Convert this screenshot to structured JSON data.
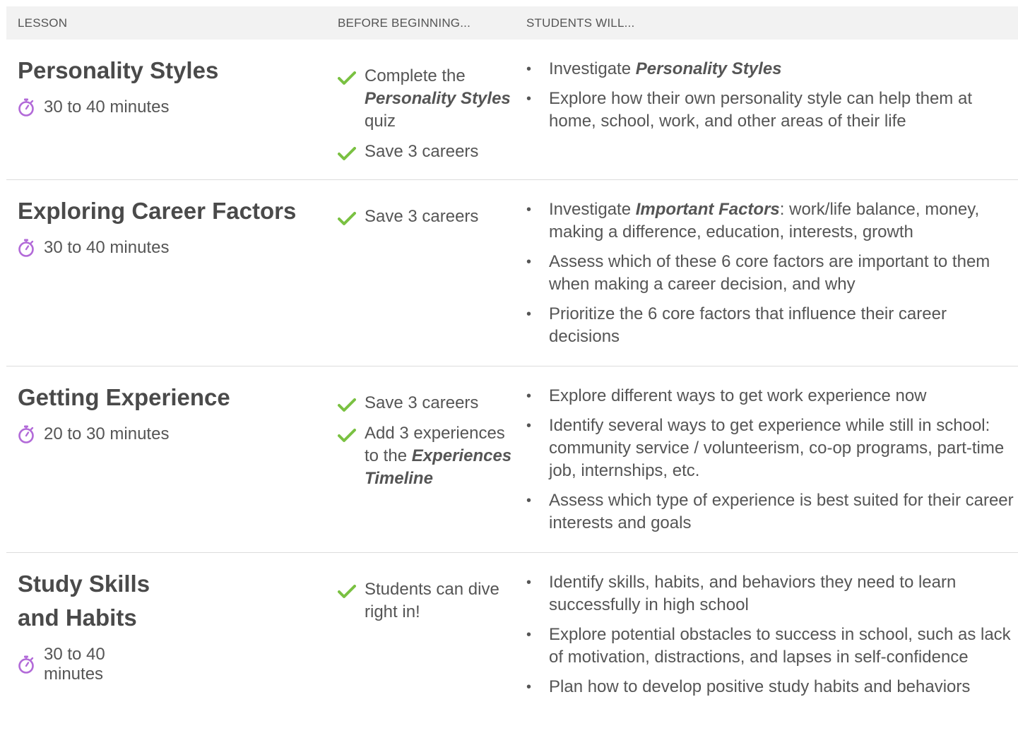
{
  "header": {
    "lesson": "LESSON",
    "before": "BEFORE BEGINNING...",
    "students": "STUDENTS WILL..."
  },
  "colors": {
    "check": "#7ac142",
    "timer": "#b26ad8",
    "header_bg": "#f2f2f2",
    "divider": "#dddddd"
  },
  "lessons": [
    {
      "title": "Personality Styles",
      "duration": "30 to 40 minutes",
      "before": [
        {
          "pre": "Complete the ",
          "em": "Personality Styles",
          "post": " quiz"
        },
        {
          "pre": "Save 3 careers",
          "em": "",
          "post": ""
        }
      ],
      "will": [
        {
          "pre": "Investigate ",
          "em": "Personality Styles",
          "post": ""
        },
        {
          "pre": "Explore how their own personality style can help them at home, school, work, and other areas of their life",
          "em": "",
          "post": ""
        }
      ]
    },
    {
      "title": "Exploring Career Factors",
      "duration": "30 to 40 minutes",
      "before": [
        {
          "pre": "Save 3 careers",
          "em": "",
          "post": ""
        }
      ],
      "will": [
        {
          "pre": "Investigate ",
          "em": "Important Factors",
          "post": ": work/life balance, money, making a difference, education, interests, growth"
        },
        {
          "pre": "Assess which of these 6 core factors are important to them when making a career decision, and why",
          "em": "",
          "post": ""
        },
        {
          "pre": "Prioritize the 6 core factors that influence their career decisions",
          "em": "",
          "post": ""
        }
      ]
    },
    {
      "title": "Getting Experience",
      "duration": "20 to 30 minutes",
      "before": [
        {
          "pre": "Save 3 careers",
          "em": "",
          "post": ""
        },
        {
          "pre": "Add 3 experiences to the ",
          "em": "Experiences Timeline",
          "post": ""
        }
      ],
      "will": [
        {
          "pre": "Explore different ways to get work experience now",
          "em": "",
          "post": ""
        },
        {
          "pre": "Identify several ways to get experience while still in school: community service / volunteerism, co-op programs, part-time job, internships, etc.",
          "em": "",
          "post": ""
        },
        {
          "pre": "Assess which type of experience is best suited for their career interests and goals",
          "em": "",
          "post": ""
        }
      ]
    },
    {
      "title": "Study Skills and Habits",
      "duration": "30 to 40 minutes",
      "before": [
        {
          "pre": "Students can dive right in!",
          "em": "",
          "post": ""
        }
      ],
      "will": [
        {
          "pre": "Identify skills, habits, and behaviors they need to learn successfully in high school",
          "em": "",
          "post": ""
        },
        {
          "pre": "Explore potential obstacles to success in school, such as lack of motivation, distractions, and lapses in self-confidence",
          "em": "",
          "post": ""
        },
        {
          "pre": "Plan how to develop positive study habits and behaviors",
          "em": "",
          "post": ""
        }
      ]
    }
  ]
}
